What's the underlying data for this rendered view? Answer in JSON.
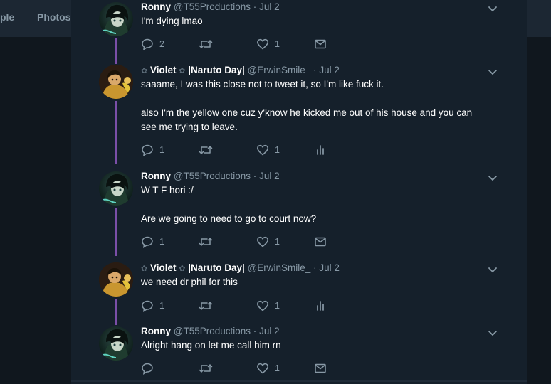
{
  "background_nav": {
    "left_fragment": "ple",
    "photos": "Photos"
  },
  "tweets": [
    {
      "name": "Ronny",
      "handle": "@T55Productions",
      "date": "Jul 2",
      "lines": [
        "I'm dying lmao"
      ],
      "replies": "2",
      "retweets": "",
      "likes": "1",
      "action4": "mail-icon"
    },
    {
      "name_prefix": "Violet",
      "name_suffix": "|Naruto Day|",
      "handle": "@ErwinSmile_",
      "date": "Jul 2",
      "lines": [
        "saaame, I was this close not to tweet it, so I'm like fuck it.",
        "",
        "also I'm the yellow one cuz y'know he kicked me out of his house and you can",
        "see me trying to leave."
      ],
      "replies": "1",
      "retweets": "",
      "likes": "1",
      "action4": "analytics-icon"
    },
    {
      "name": "Ronny",
      "handle": "@T55Productions",
      "date": "Jul 2",
      "lines": [
        "W T F hori :/",
        "",
        "Are we going to need to go to court now?"
      ],
      "replies": "1",
      "retweets": "",
      "likes": "1",
      "action4": "mail-icon"
    },
    {
      "name_prefix": "Violet",
      "name_suffix": "|Naruto Day|",
      "handle": "@ErwinSmile_",
      "date": "Jul 2",
      "lines": [
        "we need dr phil for this"
      ],
      "replies": "1",
      "retweets": "",
      "likes": "1",
      "action4": "analytics-icon"
    },
    {
      "name": "Ronny",
      "handle": "@T55Productions",
      "date": "Jul 2",
      "lines": [
        "Alright hang on let me call him rn"
      ],
      "replies": "",
      "retweets": "",
      "likes": "1",
      "action4": "mail-icon"
    }
  ],
  "separator": "·",
  "colors": {
    "page_bg": "#10171e",
    "panel_bg": "#15202b",
    "thread_line": "#7b4fa8",
    "secondary_text": "#8899a6"
  }
}
